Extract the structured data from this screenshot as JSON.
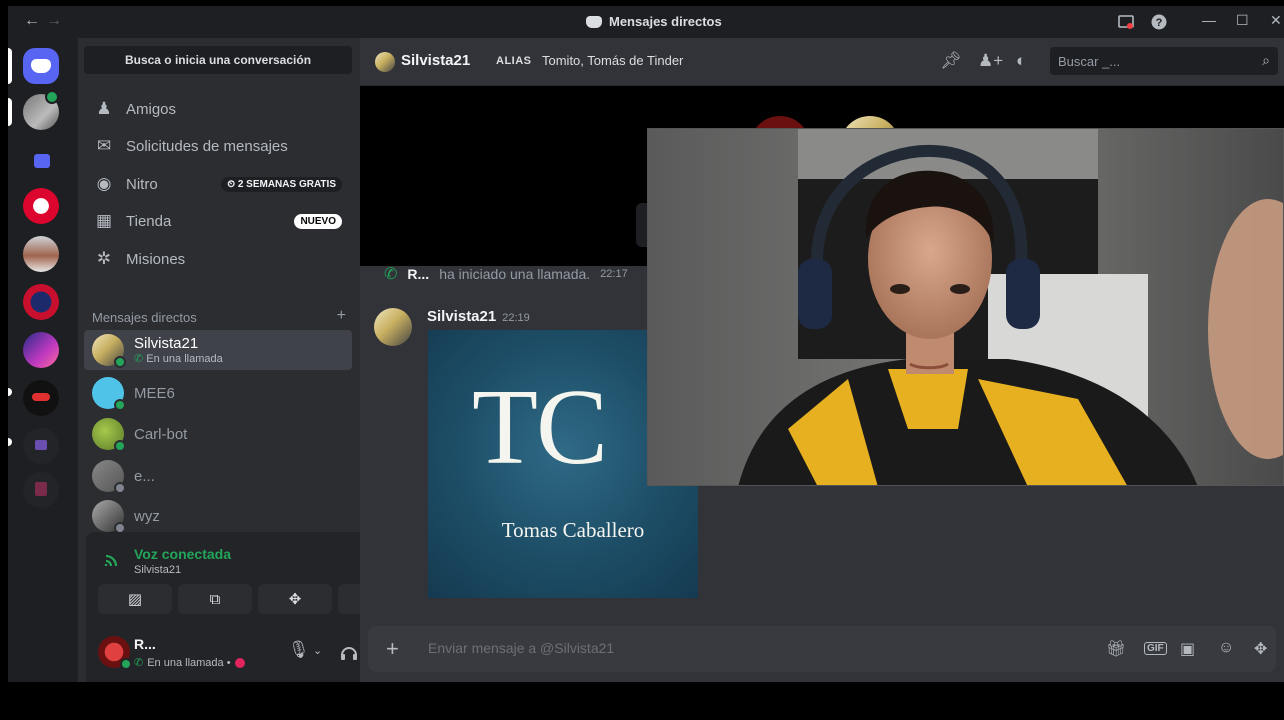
{
  "window": {
    "title": "Mensajes directos",
    "back_icon": "←",
    "forward_icon": "→",
    "min_icon": "—",
    "max_icon": "☐",
    "close_icon": "✕"
  },
  "sidebar": {
    "search_label": "Busca o inicia una conversación",
    "nav": [
      {
        "label": "Amigos",
        "icon": "friends-icon"
      },
      {
        "label": "Solicitudes de mensajes",
        "icon": "mail-icon"
      },
      {
        "label": "Nitro",
        "icon": "nitro-icon",
        "badge": "2 SEMANAS GRATIS"
      },
      {
        "label": "Tienda",
        "icon": "shop-icon",
        "badge": "NUEVO"
      },
      {
        "label": "Misiones",
        "icon": "quests-icon"
      }
    ],
    "dm_header": "Mensajes directos",
    "dm_add": "+",
    "dms": [
      {
        "name": "Silvista21",
        "sub": "En una llamada"
      },
      {
        "name": "MEE6"
      },
      {
        "name": "Carl-bot"
      },
      {
        "name": "e..."
      },
      {
        "name": "wyz"
      }
    ]
  },
  "voice": {
    "title": "Voz conectada",
    "channel": "Silvista21"
  },
  "user": {
    "name": "R...",
    "status": "En una llamada •"
  },
  "header": {
    "name": "Silvista21",
    "alias_label": "ALIAS",
    "alias_value": "Tomito, Tomás de Tinder",
    "search_placeholder": "Buscar _..."
  },
  "messages": {
    "system_name": "R...",
    "system_text": "ha iniciado una llamada.",
    "system_time": "22:17",
    "author": "Silvista21",
    "time": "22:19",
    "image_title": "TC",
    "image_caption": "Tomas Caballero"
  },
  "composer": {
    "placeholder": "Enviar mensaje a @Silvista21"
  },
  "colors": {
    "accent": "#5865f2",
    "online": "#23a55a",
    "background": "#313338"
  }
}
